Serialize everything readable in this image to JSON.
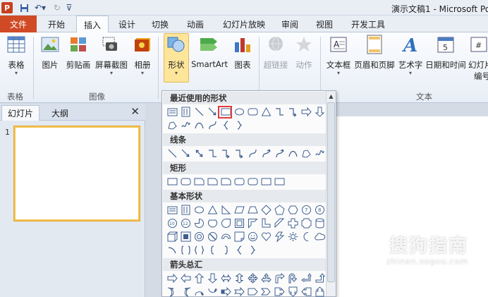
{
  "window": {
    "title": "演示文稿1 - Microsoft Po"
  },
  "tabs": {
    "file": "文件",
    "items": [
      "开始",
      "插入",
      "设计",
      "切换",
      "动画",
      "幻灯片放映",
      "审阅",
      "视图",
      "开发工具"
    ],
    "active": "插入"
  },
  "ribbon": {
    "table": "表格",
    "picture": "图片",
    "clipart": "剪贴画",
    "screenshot": "屏幕截图",
    "album": "相册",
    "shapes": "形状",
    "smartart": "SmartArt",
    "chart": "图表",
    "hyperlink": "超链接",
    "action": "动作",
    "textbox": "文本框",
    "header_footer": "页眉和页脚",
    "wordart": "艺术字",
    "datetime": "日期和时间",
    "slide_number": "幻灯片",
    "slide_number_2": "编号",
    "groups": {
      "table": "表格",
      "images": "图像",
      "text": "文本"
    }
  },
  "pane": {
    "tab_slides": "幻灯片",
    "tab_outline": "大纲",
    "close": "✕",
    "slide_number": "1"
  },
  "gallery": {
    "recent": "最近使用的形状",
    "lines": "线条",
    "rectangles": "矩形",
    "basic": "基本形状",
    "arrows": "箭头总汇"
  },
  "watermark": {
    "text": "搜狗指南",
    "url": "zhinan.sogou.com"
  },
  "colors": {
    "accent": "#d04a25",
    "highlight": "#e23b3b",
    "selected": "#fde59a"
  }
}
